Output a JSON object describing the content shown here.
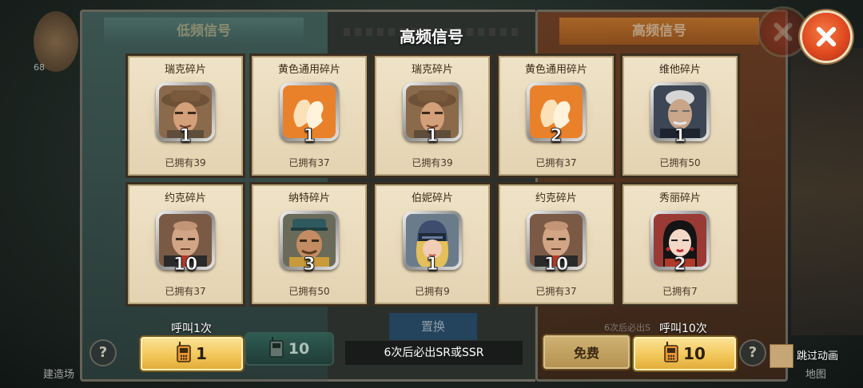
{
  "background": {
    "tab_low": "低频信号",
    "tab_high": "高频信号",
    "avatar_level": "68",
    "swap_label": "置换",
    "right_hint": "6次后必出S",
    "left_bottom_label": "建造场",
    "right_bottom_label": "地图",
    "help_symbol": "?"
  },
  "popup": {
    "title": "高频信号",
    "cards": [
      {
        "name": "瑞克碎片",
        "count": "1",
        "owned": "已拥有39",
        "portrait": "rick"
      },
      {
        "name": "黄色通用碎片",
        "count": "1",
        "owned": "已拥有37",
        "portrait": "generic"
      },
      {
        "name": "瑞克碎片",
        "count": "1",
        "owned": "已拥有39",
        "portrait": "rick"
      },
      {
        "name": "黄色通用碎片",
        "count": "2",
        "owned": "已拥有37",
        "portrait": "generic"
      },
      {
        "name": "维他碎片",
        "count": "1",
        "owned": "已拥有50",
        "portrait": "vita"
      },
      {
        "name": "约克碎片",
        "count": "10",
        "owned": "已拥有37",
        "portrait": "york"
      },
      {
        "name": "纳特碎片",
        "count": "3",
        "owned": "已拥有50",
        "portrait": "nat"
      },
      {
        "name": "伯妮碎片",
        "count": "1",
        "owned": "已拥有9",
        "portrait": "bonnie"
      },
      {
        "name": "约克碎片",
        "count": "10",
        "owned": "已拥有37",
        "portrait": "york"
      },
      {
        "name": "秀丽碎片",
        "count": "2",
        "owned": "已拥有7",
        "portrait": "xiuli"
      }
    ]
  },
  "controls": {
    "call_once_label": "呼叫1次",
    "call_once_cost": "1",
    "dim_left_cost": "10",
    "pity_text": "6次后必出SR或SSR",
    "free_label": "免费",
    "call_ten_label": "呼叫10次",
    "call_ten_cost": "10",
    "skip_label": "跳过动画"
  },
  "colors": {
    "card_bg": "#e8dabb",
    "gold_button": "#f3c75a",
    "close_button": "#e04a1f",
    "generic_fragment": "#e9812a"
  },
  "icons": {
    "walkie_talkie": "walkie-talkie-icon",
    "close": "close-icon"
  }
}
